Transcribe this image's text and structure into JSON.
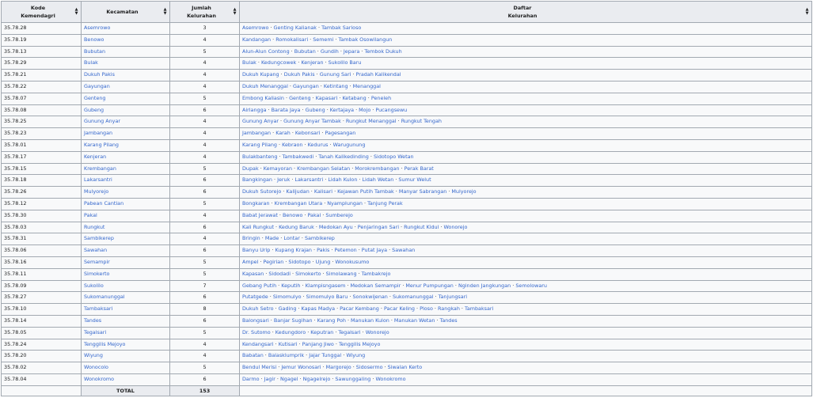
{
  "headers": {
    "kode_line1": "Kode",
    "kode_line2": "Kemendagri",
    "kecamatan": "Kecamatan",
    "jumlah_line1": "Jumlah",
    "jumlah_line2": "Kelurahan",
    "daftar_line1": "Daftar",
    "daftar_line2": "Kelurahan"
  },
  "rows": [
    {
      "kode": "35.78.28",
      "kecamatan": "Asemrowo",
      "jumlah": "3",
      "kelurahan": [
        "Asemrowo",
        "Genting Kalianak",
        "Tambak Sarioso"
      ]
    },
    {
      "kode": "35.78.19",
      "kecamatan": "Benowo",
      "jumlah": "4",
      "kelurahan": [
        "Kandangan",
        "Romokalisari",
        "Sememi",
        "Tambak Osowilangun"
      ]
    },
    {
      "kode": "35.78.13",
      "kecamatan": "Bubutan",
      "jumlah": "5",
      "kelurahan": [
        "Alun-Alun Contong",
        "Bubutan",
        "Gundih",
        "Jepara",
        "Tembok Dukuh"
      ]
    },
    {
      "kode": "35.78.29",
      "kecamatan": "Bulak",
      "jumlah": "4",
      "kelurahan": [
        "Bulak",
        "Kedungcowek",
        "Kenjeran",
        "Sukolilo Baru"
      ]
    },
    {
      "kode": "35.78.21",
      "kecamatan": "Dukuh Pakis",
      "jumlah": "4",
      "kelurahan": [
        "Dukuh Kupang",
        "Dukuh Pakis",
        "Gunung Sari",
        "Pradah Kalikendal"
      ]
    },
    {
      "kode": "35.78.22",
      "kecamatan": "Gayungan",
      "jumlah": "4",
      "kelurahan": [
        "Dukuh Menanggal",
        "Gayungan",
        "Ketintang",
        "Menanggal"
      ]
    },
    {
      "kode": "35.78.07",
      "kecamatan": "Genteng",
      "jumlah": "5",
      "kelurahan": [
        "Embong Kaliasin",
        "Genteng",
        "Kapasari",
        "Ketabang",
        "Peneleh"
      ]
    },
    {
      "kode": "35.78.08",
      "kecamatan": "Gubeng",
      "jumlah": "6",
      "kelurahan": [
        "Airlangga",
        "Barata Jaya",
        "Gubeng",
        "Kertajaya",
        "Mojo",
        "Pucangsewu"
      ]
    },
    {
      "kode": "35.78.25",
      "kecamatan": "Gunung Anyar",
      "jumlah": "4",
      "kelurahan": [
        "Gunung Anyar",
        "Gunung Anyar Tambak",
        "Rungkut Menanggal",
        "Rungkut Tengah"
      ]
    },
    {
      "kode": "35.78.23",
      "kecamatan": "Jambangan",
      "jumlah": "4",
      "kelurahan": [
        "Jambangan",
        "Karah",
        "Kebonsari",
        "Pagesangan"
      ]
    },
    {
      "kode": "35.78.01",
      "kecamatan": "Karang Pilang",
      "jumlah": "4",
      "kelurahan": [
        "Karang Pilang",
        "Kebraon",
        "Kedurus",
        "Warugunung"
      ]
    },
    {
      "kode": "35.78.17",
      "kecamatan": "Kenjeran",
      "jumlah": "4",
      "kelurahan": [
        "Bulakbanteng",
        "Tambakwedi",
        "Tanah Kalikedinding",
        "Sidotopo Wetan"
      ]
    },
    {
      "kode": "35.78.15",
      "kecamatan": "Krembangan",
      "jumlah": "5",
      "kelurahan": [
        "Dupak",
        "Kemayoran",
        "Krembangan Selatan",
        "Morokrembangan",
        "Perak Barat"
      ]
    },
    {
      "kode": "35.78.18",
      "kecamatan": "Lakarsantri",
      "jumlah": "6",
      "kelurahan": [
        "Bangkingan",
        "Jeruk",
        "Lakarsantri",
        "Lidah Kulon",
        "Lidah Wetan",
        "Sumur Welut"
      ]
    },
    {
      "kode": "35.78.26",
      "kecamatan": "Mulyorejo",
      "jumlah": "6",
      "kelurahan": [
        "Dukuh Sutorejo",
        "Kalijudan",
        "Kalisari",
        "Kejawan Putih Tambak",
        "Manyar Sabrangan",
        "Mulyorejo"
      ]
    },
    {
      "kode": "35.78.12",
      "kecamatan": "Pabean Cantian",
      "jumlah": "5",
      "kelurahan": [
        "Bongkaran",
        "Krembangan Utara",
        "Nyamplungan",
        "Tanjung Perak"
      ]
    },
    {
      "kode": "35.78.30",
      "kecamatan": "Pakal",
      "jumlah": "4",
      "kelurahan": [
        "Babat Jerawat",
        "Benowo",
        "Pakal",
        "Sumberejo"
      ]
    },
    {
      "kode": "35.78.03",
      "kecamatan": "Rungkut",
      "jumlah": "6",
      "kelurahan": [
        "Kali Rungkut",
        "Kedung Baruk",
        "Medokan Ayu",
        "Penjaringan Sari",
        "Rungkut Kidul",
        "Wonorejo"
      ]
    },
    {
      "kode": "35.78.31",
      "kecamatan": "Sambikerep",
      "jumlah": "4",
      "kelurahan": [
        "Bringin",
        "Made",
        "Lontar",
        "Sambikerep"
      ]
    },
    {
      "kode": "35.78.06",
      "kecamatan": "Sawahan",
      "jumlah": "6",
      "kelurahan": [
        "Banyu Urip",
        "Kupang Krajan",
        "Pakis",
        "Petemon",
        "Putat Jaya",
        "Sawahan"
      ]
    },
    {
      "kode": "35.78.16",
      "kecamatan": "Semampir",
      "jumlah": "5",
      "kelurahan": [
        "Ampel",
        "Pegirian",
        "Sidotopo",
        "Ujung",
        "Wonokusumo"
      ]
    },
    {
      "kode": "35.78.11",
      "kecamatan": "Simokerto",
      "jumlah": "5",
      "kelurahan": [
        "Kapasan",
        "Sidodadi",
        "Simokerto",
        "Simolawang",
        "Tambakrejo"
      ]
    },
    {
      "kode": "35.78.09",
      "kecamatan": "Sukolilo",
      "jumlah": "7",
      "kelurahan": [
        "Gebang Putih",
        "Keputih",
        "Klampisngasem",
        "Medokan Semampir",
        "Menur Pumpungan",
        "Nginden Jangkungan",
        "Semolowaru"
      ]
    },
    {
      "kode": "35.78.27",
      "kecamatan": "Sukomanunggal",
      "jumlah": "6",
      "kelurahan": [
        "Putatgede",
        "Simomulyo",
        "Simomulyo Baru",
        "Sonokwijenan",
        "Sukomanunggal",
        "Tanjungsari"
      ]
    },
    {
      "kode": "35.78.10",
      "kecamatan": "Tambaksari",
      "jumlah": "8",
      "kelurahan": [
        "Dukuh Setro",
        "Gading",
        "Kapas Madya",
        "Pacar Kembang",
        "Pacar Keling",
        "Ploso",
        "Rangkah",
        "Tambaksari"
      ]
    },
    {
      "kode": "35.78.14",
      "kecamatan": "Tandes",
      "jumlah": "6",
      "kelurahan": [
        "Balongsari",
        "Banjar Sugihan",
        "Karang Poh",
        "Manukan Kulon",
        "Manukan Wetan",
        "Tandes"
      ]
    },
    {
      "kode": "35.78.05",
      "kecamatan": "Tegalsari",
      "jumlah": "5",
      "kelurahan": [
        "Dr. Sutomo",
        "Kedungdoro",
        "Keputran",
        "Tegalsari",
        "Wonorejo"
      ]
    },
    {
      "kode": "35.78.24",
      "kecamatan": "Tenggilis Mejoyo",
      "jumlah": "4",
      "kelurahan": [
        "Kendangsari",
        "Kutisari",
        "Panjang Jiwo",
        "Tenggilis Mejoyo"
      ]
    },
    {
      "kode": "35.78.20",
      "kecamatan": "Wiyung",
      "jumlah": "4",
      "kelurahan": [
        "Babatan",
        "Balasklumprik",
        "Jajar Tunggal",
        "Wiyung"
      ]
    },
    {
      "kode": "35.78.02",
      "kecamatan": "Wonocolo",
      "jumlah": "5",
      "kelurahan": [
        "Bendul Merisi",
        "Jemur Wonosari",
        "Margorejo",
        "Sidosermo",
        "Siwalan Kerto"
      ]
    },
    {
      "kode": "35.78.04",
      "kecamatan": "Wonokromo",
      "jumlah": "6",
      "kelurahan": [
        "Darmo",
        "Jagir",
        "Ngagel",
        "Ngagelrejo",
        "Sawunggaling",
        "Wonokromo"
      ]
    }
  ],
  "footer": {
    "total_label": "TOTAL",
    "total_value": "153"
  },
  "separator": " · ",
  "icons": {
    "sort": "sort-icon"
  },
  "colors": {
    "link": "#3366cc",
    "header_bg": "#eaecf0",
    "cell_bg": "#f8f9fa",
    "border": "#a2a9b1"
  }
}
